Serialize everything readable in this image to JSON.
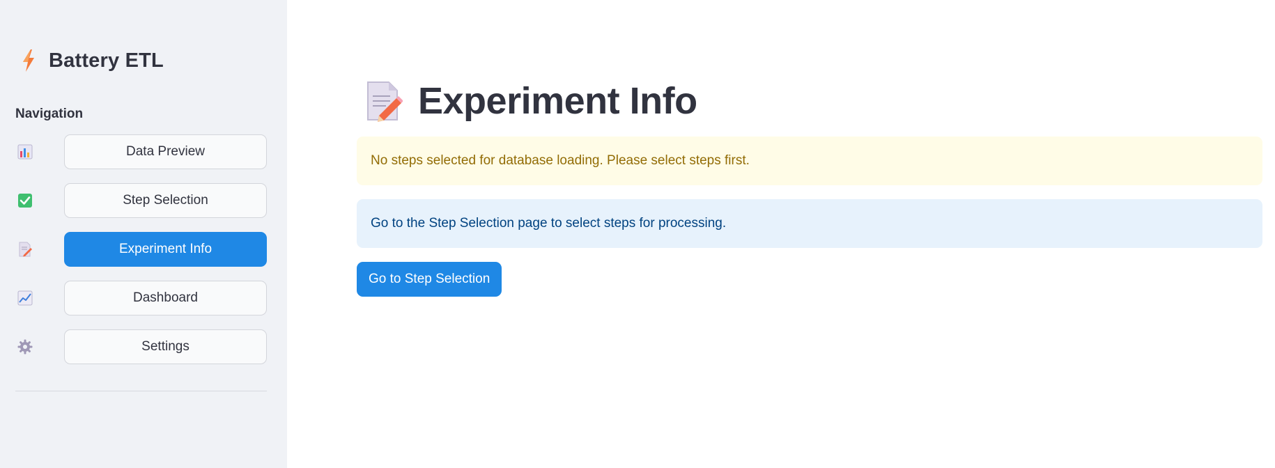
{
  "sidebar": {
    "brand": {
      "icon": "lightning-bolt-icon",
      "title": "Battery ETL"
    },
    "nav_heading": "Navigation",
    "items": [
      {
        "icon": "bar-chart-icon",
        "label": "Data Preview",
        "active": false
      },
      {
        "icon": "check-box-icon",
        "label": "Step Selection",
        "active": false
      },
      {
        "icon": "memo-pencil-icon",
        "label": "Experiment Info",
        "active": true
      },
      {
        "icon": "line-chart-icon",
        "label": "Dashboard",
        "active": false
      },
      {
        "icon": "gear-icon",
        "label": "Settings",
        "active": false
      }
    ]
  },
  "main": {
    "title_icon": "memo-pencil-icon",
    "title": "Experiment Info",
    "warning": "No steps selected for database loading. Please select steps first.",
    "info": "Go to the Step Selection page to select steps for processing.",
    "button_label": "Go to Step Selection"
  },
  "colors": {
    "accent": "#1f88e5",
    "sidebar_bg": "#f0f2f6",
    "warning_bg": "#fffce7",
    "warning_text": "#926c05",
    "info_bg": "#e7f2fc",
    "info_text": "#004280"
  }
}
